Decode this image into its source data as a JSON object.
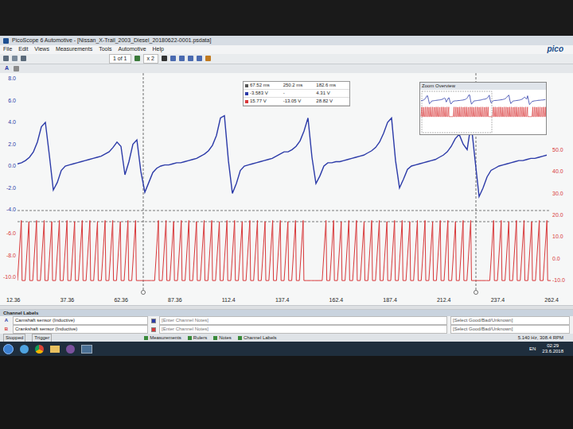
{
  "window": {
    "title": "PicoScope 6 Automotive - [Nissan_X-Trail_2003_Diesel_20180622-0001.psdata]",
    "logo": "pico"
  },
  "menu": [
    "File",
    "Edit",
    "Views",
    "Measurements",
    "Tools",
    "Automotive",
    "Help"
  ],
  "toolbar": {
    "page": "1 of 1",
    "zoom": "x 2",
    "channel": "A"
  },
  "chart": {
    "leftAxisA": [
      "8.0",
      "6.0",
      "4.0",
      "2.0",
      "0.0",
      "-2.0",
      "-4.0"
    ],
    "leftAxisB": [
      "-6.0",
      "-8.0",
      "-10.0"
    ],
    "rightAxisB": [
      "50.0",
      "40.0",
      "30.0",
      "20.0",
      "10.0",
      "0.0",
      "-10.0"
    ],
    "timeAxis": [
      "12.36",
      "37.36",
      "62.36",
      "87.36",
      "112.4",
      "137.4",
      "162.4",
      "187.4",
      "212.4",
      "237.4",
      "262.4"
    ],
    "series": [
      {
        "name": "A",
        "color": "#2b3aa8",
        "values": [
          0.2,
          0.3,
          0.5,
          0.8,
          1.3,
          2.2,
          3.6,
          4.0,
          1.0,
          -2.2,
          -1.5,
          -0.4,
          0.0,
          0.1,
          0.2,
          0.3,
          0.4,
          0.5,
          0.6,
          0.7,
          0.8,
          0.9,
          1.1,
          1.3,
          1.7,
          2.2,
          1.8,
          -0.8,
          0.4,
          2.0,
          2.4,
          -0.5,
          -2.4,
          -1.5,
          -0.6,
          -0.2,
          0.0,
          0.1,
          0.1,
          0.2,
          0.3,
          0.3,
          0.4,
          0.5,
          0.6,
          0.7,
          0.9,
          1.1,
          1.4,
          1.9,
          2.8,
          4.4,
          4.6,
          0.5,
          -2.5,
          -1.6,
          -0.4,
          0.0,
          0.1,
          0.2,
          0.3,
          0.4,
          0.5,
          0.6,
          0.7,
          0.9,
          1.1,
          1.3,
          1.3,
          1.5,
          1.8,
          2.3,
          3.2,
          4.4,
          0.8,
          -1.6,
          -0.9,
          0.0,
          0.3,
          0.3,
          0.4,
          0.4,
          0.5,
          0.6,
          0.7,
          0.8,
          0.9,
          1.0,
          1.2,
          1.4,
          1.7,
          2.2,
          3.0,
          4.0,
          4.4,
          0.5,
          -2.0,
          -1.2,
          -0.3,
          0.0,
          0.1,
          0.2,
          0.3,
          0.4,
          0.5,
          0.6,
          0.8,
          1.0,
          1.3,
          1.8,
          2.5,
          2.9,
          2.0,
          1.5,
          3.9,
          0.5,
          -2.8,
          -2.0,
          -1.0,
          -0.4,
          -0.2,
          0.0,
          0.1,
          0.2,
          0.3,
          0.4,
          0.5,
          0.5,
          0.6,
          0.7,
          0.7,
          0.8,
          0.9,
          1.0
        ]
      },
      {
        "name": "B",
        "color": "#d8383a",
        "trough": -10.3,
        "values": [
          -4.8,
          -4.9,
          -4.8,
          -4.8,
          -4.9,
          -4.8,
          -4.8,
          -4.9,
          -4.8,
          -4.8,
          -4.9,
          -4.8,
          -4.8,
          -4.9,
          -4.8,
          -4.8,
          -10.3,
          -10.3,
          -4.8,
          -4.8,
          -4.9,
          -4.8,
          -4.8,
          -4.9,
          -4.8,
          -4.8,
          -4.9,
          -4.8,
          -4.8,
          -4.9,
          -4.8,
          -4.8,
          -4.9,
          -4.8,
          -4.8,
          -4.9,
          -4.8,
          -4.8,
          -10.3,
          -10.3,
          -4.8,
          -4.8,
          -4.9,
          -4.8,
          -4.8,
          -4.9,
          -4.8,
          -4.8,
          -4.9,
          -4.8,
          -4.8,
          -4.9,
          -4.8,
          -4.8,
          -4.9,
          -4.8,
          -4.8,
          -4.9,
          -4.8,
          -4.8,
          -10.3,
          -10.3,
          -4.8,
          -4.8,
          -4.9,
          -4.8,
          -4.8,
          -4.9,
          -4.8,
          -4.8
        ]
      }
    ]
  },
  "rulerBox": {
    "rows": [
      {
        "color": "#555555",
        "cells": [
          "67.52 ms",
          "250.2 ms",
          "182.6 ms"
        ]
      },
      {
        "color": "#2b3aa8",
        "cells": [
          "-3.583 V",
          "-",
          "4.31 V"
        ]
      },
      {
        "color": "#d8383a",
        "cells": [
          "15.77 V",
          "-13.05 V",
          "28.82 V"
        ]
      }
    ]
  },
  "zoomOverview": {
    "title": "Zoom Overview"
  },
  "channelLabels": {
    "title": "Channel Labels",
    "rows": [
      {
        "channel": "A",
        "name": "Camshaft sensor (Inductive)",
        "notes": "[Enter Channel Notes]",
        "rating": "[Select Good/Bad/Unknown]",
        "color": "#2b3aa8"
      },
      {
        "channel": "B",
        "name": "Crankshaft sensor (Inductive)",
        "notes": "[Enter Channel Notes]",
        "rating": "[Select Good/Bad/Unknown]",
        "color": "#d8383a"
      }
    ]
  },
  "statusBar": {
    "run": "Stopped",
    "trigger": "Trigger",
    "tabs": [
      "Measurements",
      "Rulers",
      "Notes",
      "Channel Labels"
    ],
    "readout": "5.140 Hz, 308.4 RPM"
  },
  "taskbar": {
    "language": "EN",
    "time": "02:29",
    "date": "23.6.2018"
  }
}
